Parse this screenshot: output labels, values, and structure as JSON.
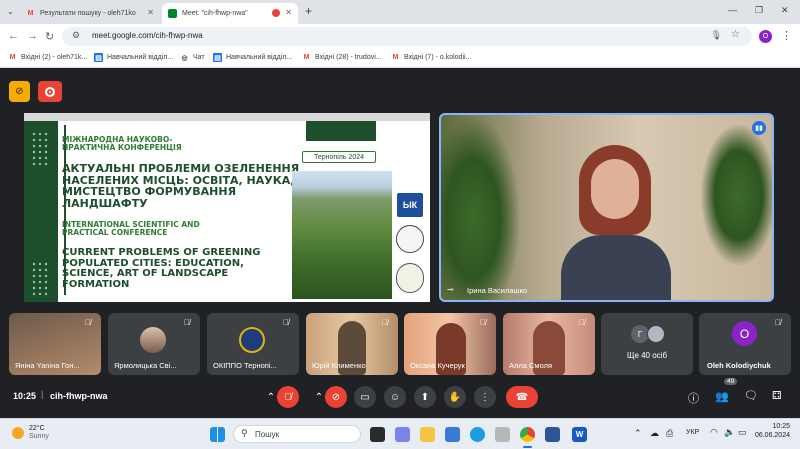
{
  "browser": {
    "tabs": [
      {
        "label": "Результати пошуку - oleh71ko",
        "icon": "gmail-icon"
      },
      {
        "label": "Meet: \"cih-fhwp-nwa\"",
        "icon": "meet-icon",
        "active": true
      }
    ],
    "url": "meet.google.com/cih-fhwp-nwa",
    "profile_initial": "O",
    "bookmarks": [
      {
        "label": "Вхідні (2) - oleh71k...",
        "icon": "gmail-icon"
      },
      {
        "label": "Навчальний відділ...",
        "icon": "doc-icon"
      },
      {
        "label": "Чат",
        "icon": "chat-icon"
      },
      {
        "label": "Навчальний відділ...",
        "icon": "doc-icon"
      },
      {
        "label": "Вхідні (28) - trudovi...",
        "icon": "gmail-icon"
      },
      {
        "label": "Вхідні (7) - o.kolodii...",
        "icon": "gmail-icon"
      }
    ]
  },
  "slide": {
    "header_ua": "МІЖНАРОДНА НАУКОВО-ПРАКТИЧНА КОНФЕРЕНЦІЯ",
    "title_ua": "АКТУАЛЬНІ ПРОБЛЕМИ ОЗЕЛЕНЕННЯ НАСЕЛЕНИХ МІСЦЬ: ОСВІТА, НАУКА, МИСТЕЦТВО ФОРМУВАННЯ ЛАНДШАФТУ",
    "header_en": "INTERNATIONAL SCIENTIFIC AND PRACTICAL CONFERENCE",
    "title_en": "CURRENT PROBLEMS OF GREENING POPULATED CITIES: EDUCATION, SCIENCE, ART OF LANDSCAPE FORMATION",
    "place_date": "Тернопіль 2024"
  },
  "speaker": {
    "name": "Ірина Василашко"
  },
  "participants": [
    {
      "name": "Яніна Yaniна Гон..."
    },
    {
      "name": "Ярмолицька Сві..."
    },
    {
      "name": "ОКІППО Тернопі..."
    },
    {
      "name": "Юрій Клименко"
    },
    {
      "name": "Оксана Кучерук"
    },
    {
      "name": "Алла Смоля"
    }
  ],
  "others": {
    "label": "Ще 40 осіб",
    "initial": "Г"
  },
  "self_tile": {
    "name": "Oleh Kolodiychuk",
    "initial": "O"
  },
  "meeting": {
    "time": "10:25",
    "code": "cih-fhwp-nwa",
    "people_count": "49"
  },
  "taskbar": {
    "weather_temp": "22°C",
    "weather_desc": "Sunny",
    "search_placeholder": "Пошук",
    "lang": "УКР",
    "clock_time": "10:25",
    "clock_date": "06.06.2024"
  },
  "colors": {
    "meet_bg": "#202124",
    "hangup": "#ea4335",
    "slide_green": "#1d4f2c",
    "avatar_purple": "#8a24c6"
  }
}
